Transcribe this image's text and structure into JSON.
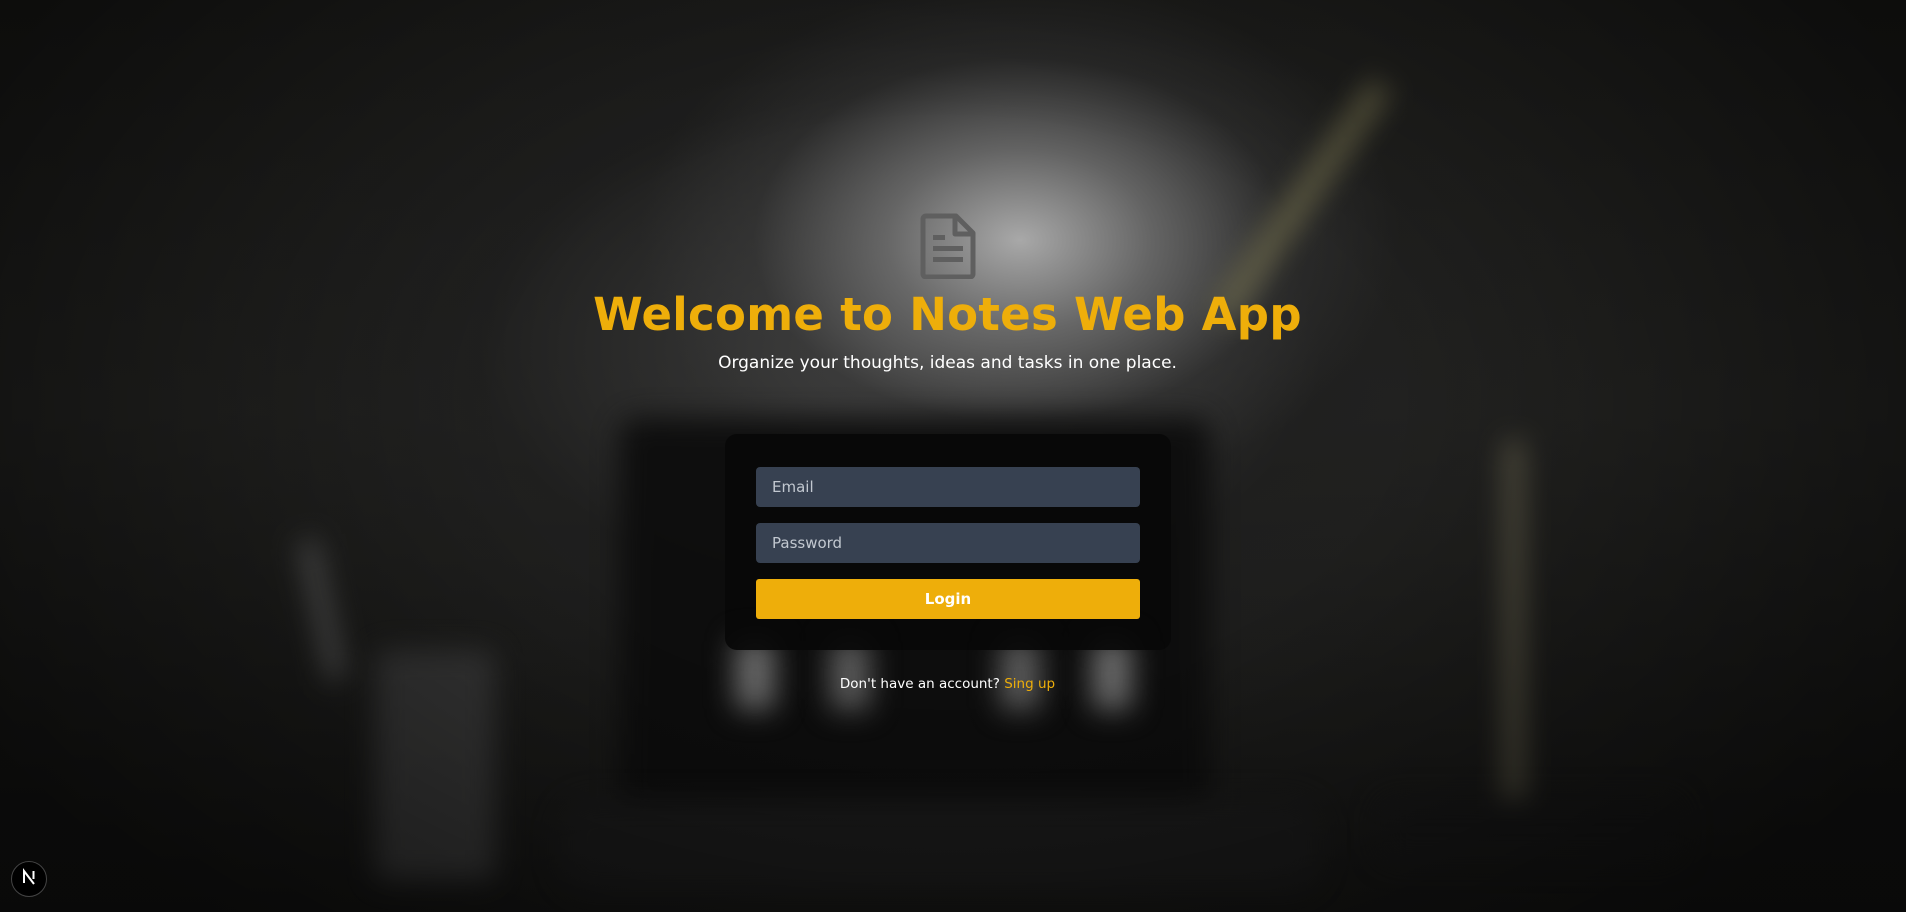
{
  "header": {
    "title": "Welcome to Notes Web App",
    "subtitle": "Organize your thoughts, ideas and tasks in one place.",
    "icon": "document-icon"
  },
  "login_form": {
    "email_placeholder": "Email",
    "email_value": "",
    "password_placeholder": "Password",
    "password_value": "",
    "login_label": "Login"
  },
  "signup": {
    "prompt": "Don't have an account?",
    "link_label": "Sing up"
  },
  "dev_badge": {
    "icon": "nextjs-logo-icon"
  },
  "colors": {
    "accent": "#eeae0a",
    "input_bg": "#374151",
    "card_bg": "#080808"
  }
}
